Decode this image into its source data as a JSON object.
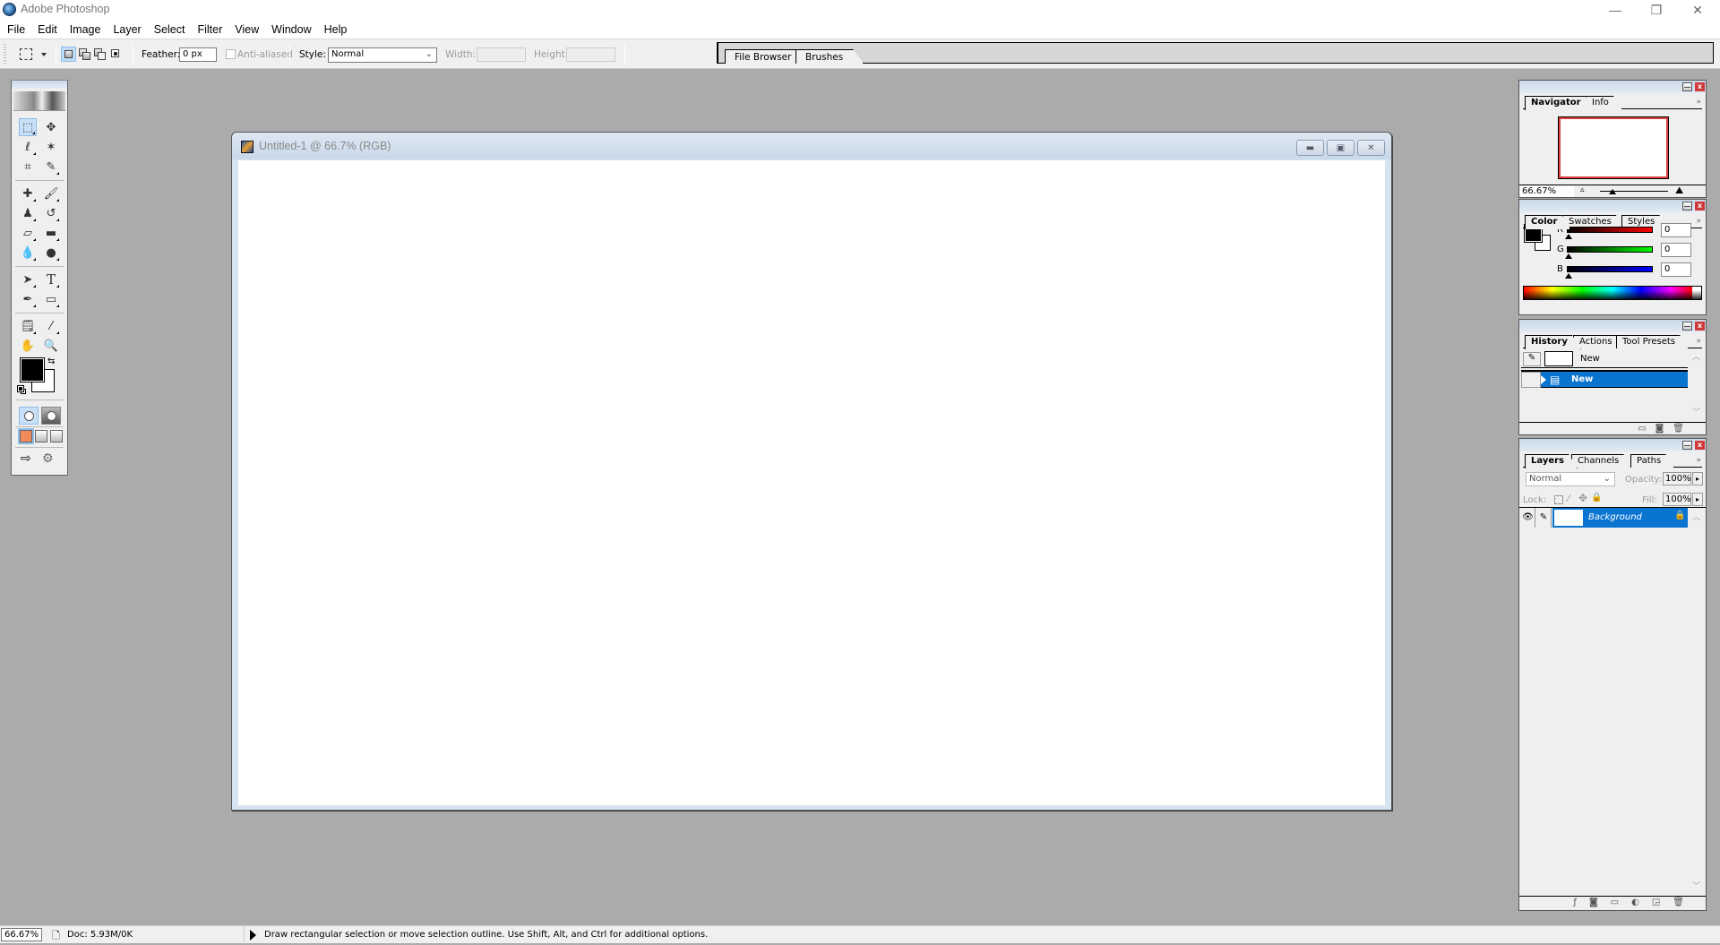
{
  "window": {
    "title": "Adobe Photoshop",
    "controls": {
      "minimize": "—",
      "restore": "❐",
      "close": "✕"
    }
  },
  "menubar": {
    "items": [
      "File",
      "Edit",
      "Image",
      "Layer",
      "Select",
      "Filter",
      "View",
      "Window",
      "Help"
    ]
  },
  "options_bar": {
    "tool_icon": "rectangular-marquee-icon",
    "feather_label": "Feather:",
    "feather_value": "0 px",
    "anti_aliased_label": "Anti-aliased",
    "anti_aliased_checked": false,
    "style_label": "Style:",
    "style_value": "Normal",
    "width_label": "Width:",
    "width_value": "",
    "height_label": "Height:",
    "height_value": ""
  },
  "palette_well": {
    "tabs": [
      "File Browser",
      "Brushes"
    ]
  },
  "toolbox": {
    "tools": [
      {
        "name": "rectangular-marquee",
        "glyph": "⬚",
        "active": true
      },
      {
        "name": "move",
        "glyph": "✥"
      },
      {
        "name": "lasso",
        "glyph": "ℓ"
      },
      {
        "name": "magic-wand",
        "glyph": "✶"
      },
      {
        "name": "crop",
        "glyph": "⌗"
      },
      {
        "name": "slice",
        "glyph": "✎"
      },
      {
        "name": "healing-brush",
        "glyph": "✚"
      },
      {
        "name": "brush",
        "glyph": "🖌"
      },
      {
        "name": "clone-stamp",
        "glyph": "♟"
      },
      {
        "name": "history-brush",
        "glyph": "↺"
      },
      {
        "name": "eraser",
        "glyph": "▱"
      },
      {
        "name": "gradient",
        "glyph": "▬"
      },
      {
        "name": "blur",
        "glyph": "💧"
      },
      {
        "name": "dodge",
        "glyph": "●"
      },
      {
        "name": "path-selection",
        "glyph": "➤"
      },
      {
        "name": "type",
        "glyph": "T"
      },
      {
        "name": "pen",
        "glyph": "✒"
      },
      {
        "name": "rectangle-shape",
        "glyph": "▭"
      },
      {
        "name": "notes",
        "glyph": "🗒"
      },
      {
        "name": "eyedropper",
        "glyph": "⁄"
      },
      {
        "name": "hand",
        "glyph": "✋"
      },
      {
        "name": "zoom",
        "glyph": "🔍"
      }
    ],
    "foreground_color": "#000000",
    "background_color": "#ffffff"
  },
  "document": {
    "title": "Untitled-1 @ 66.7% (RGB)",
    "canvas_color": "#ffffff"
  },
  "navigator_panel": {
    "tabs": [
      "Navigator",
      "Info"
    ],
    "active_tab": "Navigator",
    "zoom_value": "66.67%",
    "proxy_color": "#e04040"
  },
  "color_panel": {
    "tabs": [
      "Color",
      "Swatches",
      "Styles"
    ],
    "active_tab": "Color",
    "channels": [
      {
        "label": "R",
        "value": "0",
        "color": "#ff0000"
      },
      {
        "label": "G",
        "value": "0",
        "color": "#00ff00"
      },
      {
        "label": "B",
        "value": "0",
        "color": "#0000ff"
      }
    ]
  },
  "history_panel": {
    "tabs": [
      "History",
      "Actions",
      "Tool Presets"
    ],
    "active_tab": "History",
    "snapshot_label": "New",
    "states": [
      {
        "label": "New",
        "selected": true
      }
    ]
  },
  "layers_panel": {
    "tabs": [
      "Layers",
      "Channels",
      "Paths"
    ],
    "active_tab": "Layers",
    "blend_mode": "Normal",
    "opacity_label": "Opacity:",
    "opacity_value": "100%",
    "lock_label": "Lock:",
    "fill_label": "Fill:",
    "fill_value": "100%",
    "layers": [
      {
        "name": "Background",
        "visible": true,
        "locked": true,
        "selected": true
      }
    ]
  },
  "status_bar": {
    "zoom": "66.67%",
    "doc_info": "Doc: 5.93M/0K",
    "hint": "Draw rectangular selection or move selection outline.  Use Shift, Alt, and Ctrl for additional options."
  },
  "colors": {
    "selection_blue": "#0a74d1",
    "workspace_gray": "#ababab"
  }
}
